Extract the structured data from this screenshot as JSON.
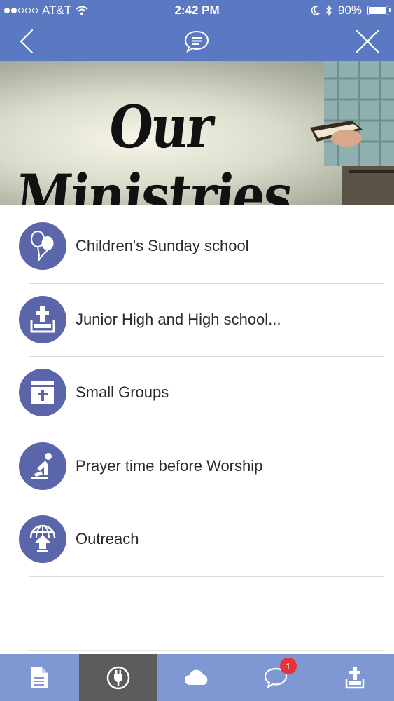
{
  "status_bar": {
    "carrier": "AT&T",
    "time": "2:42 PM",
    "battery": "90%",
    "battery_level": 0.9,
    "signal_bars": 2
  },
  "nav": {
    "back_icon": "chevron-left-icon",
    "center_icon": "chat-icon",
    "close_icon": "close-icon"
  },
  "banner": {
    "title": "Our Ministries"
  },
  "list": {
    "items": [
      {
        "label": "Children's Sunday school",
        "icon": "balloons-icon"
      },
      {
        "label": "Junior High and High school...",
        "icon": "bible-upload-icon"
      },
      {
        "label": "Small Groups",
        "icon": "bible-book-icon"
      },
      {
        "label": "Prayer time before Worship",
        "icon": "praying-person-icon"
      },
      {
        "label": "Outreach",
        "icon": "globe-arrow-icon"
      }
    ]
  },
  "tabs": {
    "items": [
      {
        "icon": "document-icon",
        "active": false
      },
      {
        "icon": "plug-icon",
        "active": true
      },
      {
        "icon": "cloud-icon",
        "active": false
      },
      {
        "icon": "chat-bubble-icon",
        "active": false,
        "badge": "1"
      },
      {
        "icon": "bible-upload-icon",
        "active": false
      }
    ]
  },
  "colors": {
    "nav_blue": "#5b79c2",
    "icon_circle": "#5a66a9",
    "tab_bar": "#7f97d2",
    "tab_active": "#5c5c5c",
    "badge_red": "#e8323a"
  }
}
